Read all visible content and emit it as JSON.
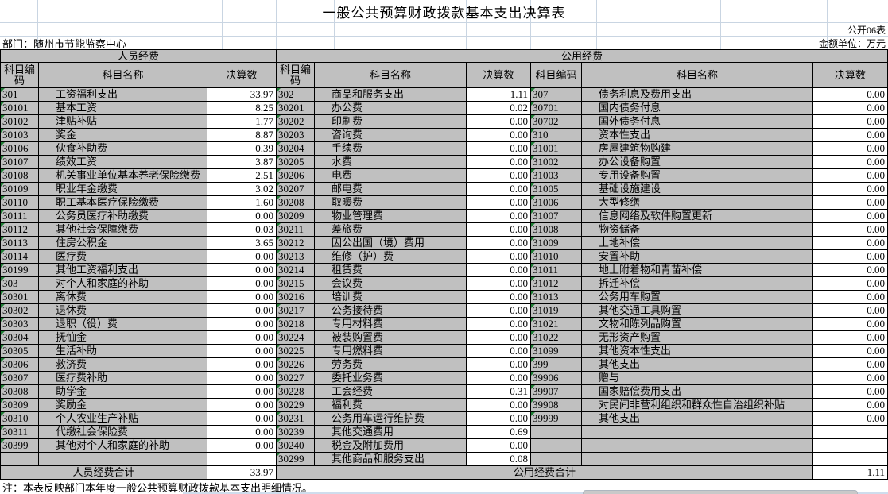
{
  "title": "一般公共预算财政拨款基本支出决算表",
  "meta": {
    "table_code": "公开06表",
    "department": "部门：随州市节能监察中心",
    "unit": "金额单位：万元"
  },
  "note": "注：本表反映部门本年度一般公共预算财政拨款基本支出明细情况。",
  "table": {
    "group_headers": {
      "personnel": "人员经费",
      "public": "公用经费"
    },
    "column_headers": {
      "code": "科目编码",
      "name": "科目名称",
      "value": "决算数"
    },
    "totals": {
      "personnel_label": "人员经费合计",
      "personnel_value": "33.97",
      "public_label": "公用经费合计",
      "public_value": "1.11"
    },
    "groups": [
      {
        "rows": [
          {
            "code": "301",
            "name": "工资福利支出",
            "value": "33.97"
          },
          {
            "code": "30101",
            "name": "基本工资",
            "value": "8.25"
          },
          {
            "code": "30102",
            "name": "津贴补贴",
            "value": "1.77"
          },
          {
            "code": "30103",
            "name": "奖金",
            "value": "8.87"
          },
          {
            "code": "30106",
            "name": "伙食补助费",
            "value": "0.39"
          },
          {
            "code": "30107",
            "name": "绩效工资",
            "value": "3.87"
          },
          {
            "code": "30108",
            "name": "机关事业单位基本养老保险缴费",
            "value": "2.51"
          },
          {
            "code": "30109",
            "name": "职业年金缴费",
            "value": "3.02"
          },
          {
            "code": "30110",
            "name": "职工基本医疗保险缴费",
            "value": "1.60"
          },
          {
            "code": "30111",
            "name": "公务员医疗补助缴费",
            "value": "0.00"
          },
          {
            "code": "30112",
            "name": "其他社会保障缴费",
            "value": "0.03"
          },
          {
            "code": "30113",
            "name": "住房公积金",
            "value": "3.65"
          },
          {
            "code": "30114",
            "name": "医疗费",
            "value": "0.00"
          },
          {
            "code": "30199",
            "name": "其他工资福利支出",
            "value": "0.00"
          },
          {
            "code": "303",
            "name": "对个人和家庭的补助",
            "value": "0.00"
          },
          {
            "code": "30301",
            "name": "离休费",
            "value": "0.00"
          },
          {
            "code": "30302",
            "name": "退休费",
            "value": "0.00"
          },
          {
            "code": "30303",
            "name": "退职（役）费",
            "value": "0.00"
          },
          {
            "code": "30304",
            "name": "抚恤金",
            "value": "0.00"
          },
          {
            "code": "30305",
            "name": "生活补助",
            "value": "0.00"
          },
          {
            "code": "30306",
            "name": "救济费",
            "value": "0.00"
          },
          {
            "code": "30307",
            "name": "医疗费补助",
            "value": "0.00"
          },
          {
            "code": "30308",
            "name": "助学金",
            "value": "0.00"
          },
          {
            "code": "30309",
            "name": "奖励金",
            "value": "0.00"
          },
          {
            "code": "30310",
            "name": "个人农业生产补贴",
            "value": "0.00"
          },
          {
            "code": "30311",
            "name": "代缴社会保险费",
            "value": "0.00"
          },
          {
            "code": "30399",
            "name": "其他对个人和家庭的补助",
            "value": "0.00"
          },
          {
            "code": "",
            "name": "",
            "value": ""
          }
        ]
      },
      {
        "rows": [
          {
            "code": "302",
            "name": "商品和服务支出",
            "value": "1.11"
          },
          {
            "code": "30201",
            "name": "办公费",
            "value": "0.02"
          },
          {
            "code": "30202",
            "name": "印刷费",
            "value": "0.00"
          },
          {
            "code": "30203",
            "name": "咨询费",
            "value": "0.00"
          },
          {
            "code": "30204",
            "name": "手续费",
            "value": "0.00"
          },
          {
            "code": "30205",
            "name": "水费",
            "value": "0.00"
          },
          {
            "code": "30206",
            "name": "电费",
            "value": "0.00"
          },
          {
            "code": "30207",
            "name": "邮电费",
            "value": "0.00"
          },
          {
            "code": "30208",
            "name": "取暖费",
            "value": "0.00"
          },
          {
            "code": "30209",
            "name": "物业管理费",
            "value": "0.00"
          },
          {
            "code": "30211",
            "name": "差旅费",
            "value": "0.00"
          },
          {
            "code": "30212",
            "name": "因公出国（境）费用",
            "value": "0.00"
          },
          {
            "code": "30213",
            "name": "维修（护）费",
            "value": "0.00"
          },
          {
            "code": "30214",
            "name": "租赁费",
            "value": "0.00"
          },
          {
            "code": "30215",
            "name": "会议费",
            "value": "0.00"
          },
          {
            "code": "30216",
            "name": "培训费",
            "value": "0.00"
          },
          {
            "code": "30217",
            "name": "公务接待费",
            "value": "0.00"
          },
          {
            "code": "30218",
            "name": "专用材料费",
            "value": "0.00"
          },
          {
            "code": "30224",
            "name": "被装购置费",
            "value": "0.00"
          },
          {
            "code": "30225",
            "name": "专用燃料费",
            "value": "0.00"
          },
          {
            "code": "30226",
            "name": "劳务费",
            "value": "0.00"
          },
          {
            "code": "30227",
            "name": "委托业务费",
            "value": "0.00"
          },
          {
            "code": "30228",
            "name": "工会经费",
            "value": "0.31"
          },
          {
            "code": "30229",
            "name": "福利费",
            "value": "0.00"
          },
          {
            "code": "30231",
            "name": "公务用车运行维护费",
            "value": "0.00"
          },
          {
            "code": "30239",
            "name": "其他交通费用",
            "value": "0.69"
          },
          {
            "code": "30240",
            "name": "税金及附加费用",
            "value": "0.00"
          },
          {
            "code": "30299",
            "name": "其他商品和服务支出",
            "value": "0.08"
          }
        ]
      },
      {
        "rows": [
          {
            "code": "307",
            "name": "债务利息及费用支出",
            "value": "0.00"
          },
          {
            "code": "30701",
            "name": "国内债务付息",
            "value": "0.00"
          },
          {
            "code": "30702",
            "name": "国外债务付息",
            "value": "0.00"
          },
          {
            "code": "310",
            "name": "资本性支出",
            "value": "0.00"
          },
          {
            "code": "31001",
            "name": "房屋建筑物购建",
            "value": "0.00"
          },
          {
            "code": "31002",
            "name": "办公设备购置",
            "value": "0.00"
          },
          {
            "code": "31003",
            "name": "专用设备购置",
            "value": "0.00"
          },
          {
            "code": "31005",
            "name": "基础设施建设",
            "value": "0.00"
          },
          {
            "code": "31006",
            "name": "大型修缮",
            "value": "0.00"
          },
          {
            "code": "31007",
            "name": "信息网络及软件购置更新",
            "value": "0.00"
          },
          {
            "code": "31008",
            "name": "物资储备",
            "value": "0.00"
          },
          {
            "code": "31009",
            "name": "土地补偿",
            "value": "0.00"
          },
          {
            "code": "31010",
            "name": "安置补助",
            "value": "0.00"
          },
          {
            "code": "31011",
            "name": "地上附着物和青苗补偿",
            "value": "0.00"
          },
          {
            "code": "31012",
            "name": "拆迁补偿",
            "value": "0.00"
          },
          {
            "code": "31013",
            "name": "公务用车购置",
            "value": "0.00"
          },
          {
            "code": "31019",
            "name": "其他交通工具购置",
            "value": "0.00"
          },
          {
            "code": "31021",
            "name": "文物和陈列品购置",
            "value": "0.00"
          },
          {
            "code": "31022",
            "name": "无形资产购置",
            "value": "0.00"
          },
          {
            "code": "31099",
            "name": "其他资本性支出",
            "value": "0.00"
          },
          {
            "code": "399",
            "name": "其他支出",
            "value": "0.00"
          },
          {
            "code": "39906",
            "name": "赠与",
            "value": "0.00"
          },
          {
            "code": "39907",
            "name": "国家赔偿费用支出",
            "value": "0.00"
          },
          {
            "code": "39908",
            "name": "对民间非营利组织和群众性自治组织补贴",
            "value": "0.00"
          },
          {
            "code": "39999",
            "name": "其他支出",
            "value": "0.00"
          },
          {
            "code": "",
            "name": "",
            "value": ""
          },
          {
            "code": "",
            "name": "",
            "value": ""
          },
          {
            "code": "",
            "name": "",
            "value": ""
          }
        ]
      }
    ]
  }
}
